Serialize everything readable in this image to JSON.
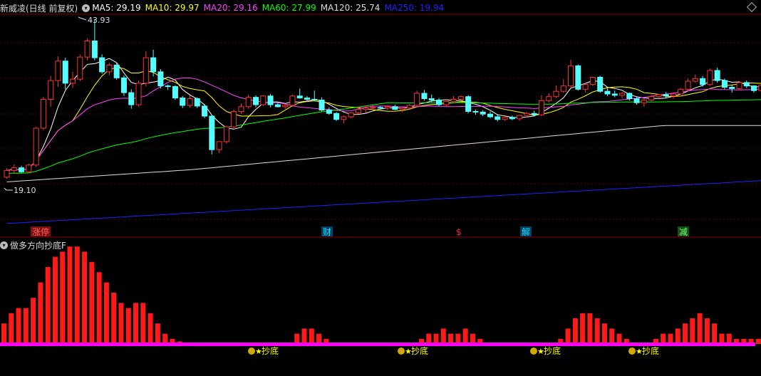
{
  "header": {
    "title": "新威凌(日线 前复权)",
    "collapse_icon": "chevron-down-icon",
    "ma_items": [
      {
        "label": "MA5: 29.19",
        "color": "#ffffff"
      },
      {
        "label": "MA10: 29.97",
        "color": "#ffff00"
      },
      {
        "label": "MA20: 29.16",
        "color": "#ff40ff"
      },
      {
        "label": "MA60: 27.99",
        "color": "#00ff00"
      },
      {
        "label": "MA120: 25.74",
        "color": "#dddddd"
      },
      {
        "label": "MA250: 19.94",
        "color": "#2020ff"
      }
    ]
  },
  "price_labels": {
    "high": "43.93",
    "low": "19.10"
  },
  "events": [
    {
      "label": "涨停",
      "color": "#ff6060",
      "bg": "#7a1010"
    },
    {
      "label": "财",
      "color": "#00e0ff",
      "bg": "#004060"
    },
    {
      "label": "$",
      "color": "#ff2020",
      "bg": "none"
    },
    {
      "label": "解",
      "color": "#00e0ff",
      "bg": "#004060"
    },
    {
      "label": "减",
      "color": "#80ff80",
      "bg": "#105010"
    }
  ],
  "indicator": {
    "title": "做多方向抄底F",
    "signal_label": "抄底",
    "signal_icon": "money-bag-star-icon",
    "bars": [
      4,
      6,
      7,
      7,
      9,
      12,
      15,
      17,
      18,
      19,
      19,
      18,
      16,
      14,
      12,
      10,
      8,
      7,
      8,
      8,
      6,
      4,
      2,
      1,
      0.5,
      0.3,
      0.2,
      0,
      0,
      0,
      0,
      0,
      0,
      0,
      0,
      0,
      0,
      0,
      0,
      0,
      2,
      3,
      3,
      2,
      1,
      0,
      0,
      0,
      0,
      0,
      0,
      0,
      0,
      0,
      0,
      0,
      0,
      1,
      2,
      2,
      3,
      2,
      2,
      3,
      2,
      1,
      0,
      0,
      0,
      0,
      0,
      0,
      0,
      0,
      0,
      0,
      1,
      3,
      5,
      6,
      6,
      5,
      4,
      3,
      2,
      1,
      0,
      0,
      0,
      1,
      2,
      2,
      3,
      4,
      5,
      6,
      5,
      4,
      2,
      2,
      1,
      1,
      1,
      1,
      0.5
    ]
  },
  "chart_data": {
    "type": "candlestick",
    "ma_colors": {
      "MA5": "#ffffff",
      "MA10": "#ffff00",
      "MA20": "#ff40ff",
      "MA60": "#00ff00",
      "MA120": "#dddddd",
      "MA250": "#2020ff"
    },
    "ohlc": [
      [
        20.5,
        21.8,
        20.3,
        21.5
      ],
      [
        21.5,
        22.4,
        21.0,
        21.9
      ],
      [
        21.9,
        22.2,
        21.1,
        21.3
      ],
      [
        21.3,
        22.5,
        21.1,
        22.3
      ],
      [
        22.3,
        28.0,
        22.0,
        27.8
      ],
      [
        27.8,
        32.5,
        27.5,
        32.1
      ],
      [
        32.1,
        35.6,
        31.0,
        34.9
      ],
      [
        34.9,
        38.5,
        34.0,
        37.8
      ],
      [
        37.8,
        38.3,
        33.6,
        34.5
      ],
      [
        34.5,
        36.2,
        33.8,
        35.1
      ],
      [
        35.1,
        38.8,
        34.8,
        38.4
      ],
      [
        38.4,
        41.2,
        37.9,
        40.8
      ],
      [
        40.8,
        43.93,
        37.9,
        38.3
      ],
      [
        38.3,
        38.8,
        35.9,
        36.2
      ],
      [
        36.2,
        37.5,
        35.7,
        37.2
      ],
      [
        37.2,
        37.6,
        35.0,
        35.3
      ],
      [
        35.3,
        35.7,
        32.6,
        33.1
      ],
      [
        33.1,
        33.6,
        30.7,
        31.3
      ],
      [
        31.3,
        34.9,
        31.0,
        34.5
      ],
      [
        34.5,
        39.3,
        34.0,
        38.3
      ],
      [
        38.3,
        39.5,
        35.5,
        36.2
      ],
      [
        36.2,
        36.6,
        33.7,
        34.1
      ],
      [
        34.1,
        34.3,
        33.5,
        34.0
      ],
      [
        34.0,
        34.2,
        32.0,
        32.3
      ],
      [
        32.3,
        32.6,
        30.8,
        31.2
      ],
      [
        31.2,
        32.7,
        30.9,
        32.2
      ],
      [
        32.2,
        32.4,
        30.8,
        31.1
      ],
      [
        31.1,
        31.4,
        29.3,
        29.6
      ],
      [
        29.6,
        29.8,
        23.9,
        24.6
      ],
      [
        24.6,
        25.4,
        24.1,
        25.8
      ],
      [
        25.8,
        28.2,
        25.5,
        28.0
      ],
      [
        28.0,
        30.6,
        27.8,
        30.3
      ],
      [
        30.3,
        31.5,
        29.9,
        31.0
      ],
      [
        31.0,
        32.8,
        30.7,
        32.4
      ],
      [
        32.4,
        32.7,
        30.9,
        31.3
      ],
      [
        31.3,
        32.7,
        31.1,
        32.6
      ],
      [
        32.6,
        32.9,
        30.9,
        31.3
      ],
      [
        31.3,
        31.6,
        30.9,
        31.0
      ],
      [
        31.0,
        31.4,
        30.7,
        31.2
      ],
      [
        31.2,
        32.8,
        31.0,
        32.6
      ],
      [
        32.6,
        33.7,
        32.2,
        32.3
      ],
      [
        32.3,
        32.6,
        31.8,
        32.1
      ],
      [
        32.1,
        33.4,
        31.9,
        32.0
      ],
      [
        32.0,
        32.4,
        30.3,
        30.5
      ],
      [
        30.5,
        30.9,
        29.8,
        30.0
      ],
      [
        30.0,
        30.2,
        28.9,
        29.1
      ],
      [
        29.1,
        29.7,
        28.5,
        29.5
      ],
      [
        29.5,
        30.2,
        29.3,
        30.1
      ],
      [
        30.1,
        31.0,
        29.9,
        30.6
      ],
      [
        30.6,
        31.2,
        30.1,
        30.8
      ],
      [
        30.8,
        31.2,
        30.4,
        30.9
      ],
      [
        30.9,
        31.1,
        30.6,
        30.8
      ],
      [
        30.8,
        31.2,
        30.5,
        31.0
      ],
      [
        31.0,
        31.3,
        30.5,
        30.6
      ],
      [
        30.6,
        30.9,
        30.2,
        30.8
      ],
      [
        30.8,
        31.4,
        30.6,
        31.2
      ],
      [
        31.2,
        33.4,
        31.0,
        33.0
      ],
      [
        33.0,
        33.5,
        31.9,
        32.2
      ],
      [
        32.2,
        32.8,
        31.7,
        32.0
      ],
      [
        32.0,
        32.3,
        31.1,
        31.3
      ],
      [
        31.3,
        32.1,
        31.0,
        31.8
      ],
      [
        31.8,
        32.6,
        31.5,
        32.1
      ],
      [
        32.1,
        32.7,
        31.8,
        32.5
      ],
      [
        32.5,
        32.7,
        30.0,
        30.3
      ],
      [
        30.3,
        30.6,
        29.8,
        30.2
      ],
      [
        30.2,
        30.5,
        29.6,
        29.9
      ],
      [
        29.9,
        30.3,
        29.3,
        29.5
      ],
      [
        29.5,
        29.9,
        28.8,
        29.1
      ],
      [
        29.1,
        29.6,
        28.9,
        29.4
      ],
      [
        29.4,
        29.7,
        29.0,
        29.2
      ],
      [
        29.2,
        29.8,
        28.9,
        29.7
      ],
      [
        29.7,
        30.2,
        29.4,
        30.0
      ],
      [
        30.0,
        30.4,
        29.6,
        29.8
      ],
      [
        29.8,
        32.7,
        29.6,
        31.9
      ],
      [
        31.9,
        33.0,
        31.6,
        32.5
      ],
      [
        32.5,
        34.2,
        32.3,
        33.3
      ],
      [
        33.3,
        35.1,
        33.1,
        34.1
      ],
      [
        34.1,
        38.0,
        33.9,
        37.1
      ],
      [
        37.1,
        37.3,
        33.4,
        33.6
      ],
      [
        33.6,
        34.5,
        33.1,
        34.3
      ],
      [
        34.3,
        35.0,
        34.1,
        35.4
      ],
      [
        35.4,
        35.6,
        33.1,
        33.3
      ],
      [
        33.3,
        33.8,
        32.6,
        32.9
      ],
      [
        32.9,
        33.4,
        32.4,
        32.7
      ],
      [
        32.7,
        33.2,
        32.3,
        33.0
      ],
      [
        33.0,
        33.1,
        31.9,
        32.2
      ],
      [
        32.2,
        32.5,
        31.3,
        31.6
      ],
      [
        31.6,
        32.2,
        31.0,
        32.0
      ],
      [
        32.0,
        32.8,
        31.8,
        32.5
      ],
      [
        32.5,
        32.9,
        32.1,
        32.8
      ],
      [
        32.8,
        33.2,
        32.3,
        32.6
      ],
      [
        32.6,
        33.0,
        32.2,
        32.9
      ],
      [
        32.9,
        33.8,
        32.8,
        33.6
      ],
      [
        33.6,
        35.2,
        33.4,
        34.8
      ],
      [
        34.8,
        35.8,
        34.6,
        35.2
      ],
      [
        35.2,
        35.6,
        34.0,
        34.3
      ],
      [
        34.3,
        36.7,
        34.1,
        36.4
      ],
      [
        36.4,
        36.8,
        34.6,
        34.9
      ],
      [
        34.9,
        35.2,
        33.6,
        33.9
      ],
      [
        33.9,
        34.2,
        33.1,
        33.7
      ],
      [
        33.7,
        34.7,
        33.5,
        34.6
      ],
      [
        34.6,
        34.9,
        33.8,
        34.1
      ],
      [
        34.1,
        34.2,
        33.1,
        33.4
      ],
      [
        33.4,
        34.5,
        33.2,
        34.2
      ]
    ]
  }
}
